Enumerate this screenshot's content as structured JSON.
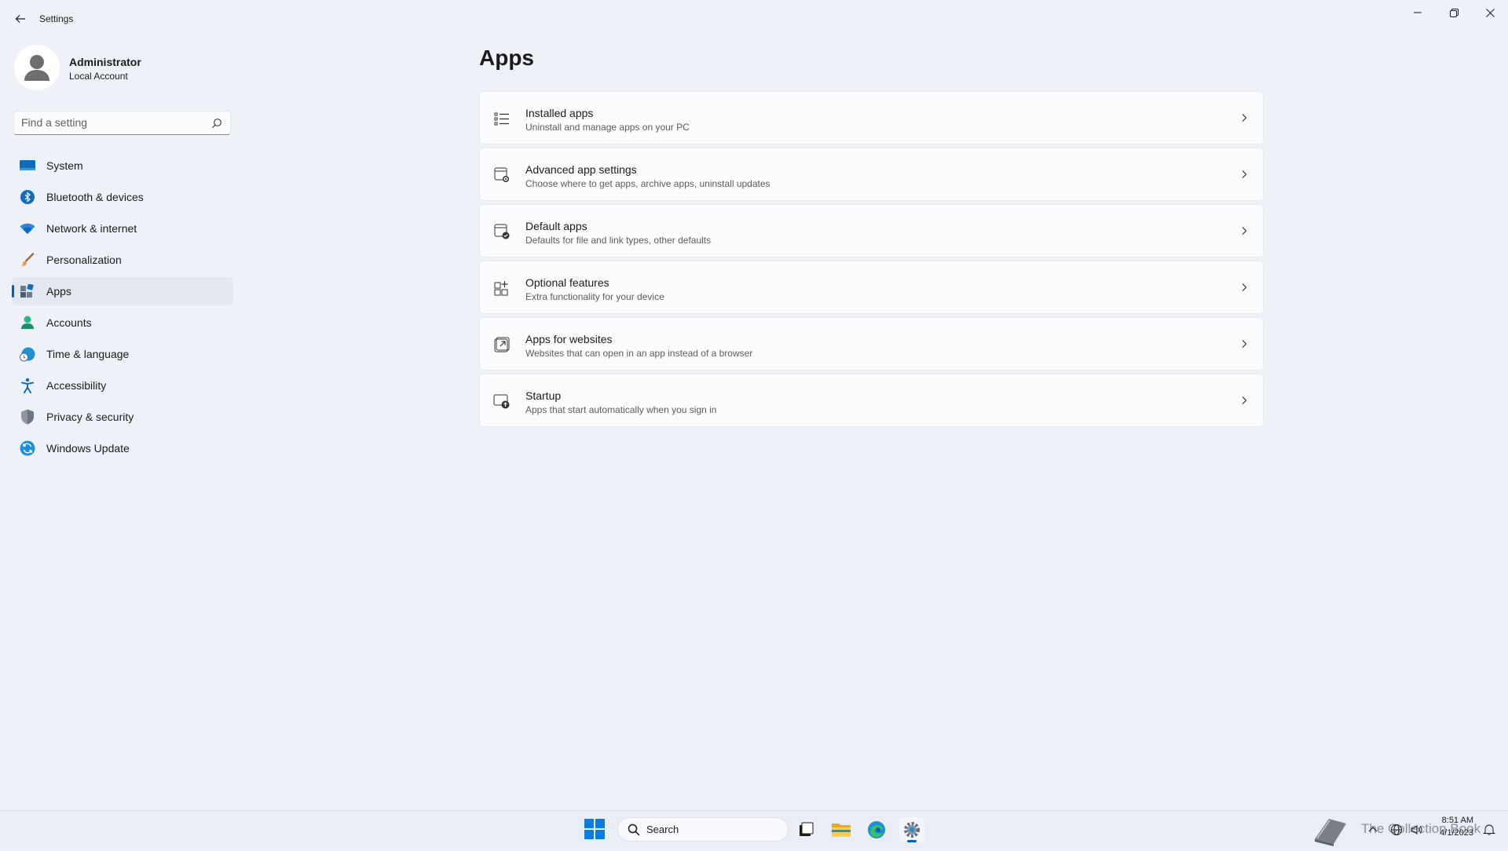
{
  "window": {
    "title": "Settings"
  },
  "profile": {
    "name": "Administrator",
    "account_type": "Local Account"
  },
  "search": {
    "placeholder": "Find a setting"
  },
  "nav": {
    "items": [
      {
        "label": "System",
        "icon": "system-icon",
        "active": false
      },
      {
        "label": "Bluetooth & devices",
        "icon": "bluetooth-icon",
        "active": false
      },
      {
        "label": "Network & internet",
        "icon": "wifi-icon",
        "active": false
      },
      {
        "label": "Personalization",
        "icon": "brush-icon",
        "active": false
      },
      {
        "label": "Apps",
        "icon": "apps-icon",
        "active": true
      },
      {
        "label": "Accounts",
        "icon": "accounts-icon",
        "active": false
      },
      {
        "label": "Time & language",
        "icon": "clock-globe-icon",
        "active": false
      },
      {
        "label": "Accessibility",
        "icon": "accessibility-icon",
        "active": false
      },
      {
        "label": "Privacy & security",
        "icon": "shield-icon",
        "active": false
      },
      {
        "label": "Windows Update",
        "icon": "update-icon",
        "active": false
      }
    ]
  },
  "main": {
    "title": "Apps",
    "cards": [
      {
        "title": "Installed apps",
        "subtitle": "Uninstall and manage apps on your PC",
        "icon": "list-icon"
      },
      {
        "title": "Advanced app settings",
        "subtitle": "Choose where to get apps, archive apps, uninstall updates",
        "icon": "app-gear-icon"
      },
      {
        "title": "Default apps",
        "subtitle": "Defaults for file and link types, other defaults",
        "icon": "default-apps-icon"
      },
      {
        "title": "Optional features",
        "subtitle": "Extra functionality for your device",
        "icon": "grid-plus-icon"
      },
      {
        "title": "Apps for websites",
        "subtitle": "Websites that can open in an app instead of a browser",
        "icon": "open-external-icon"
      },
      {
        "title": "Startup",
        "subtitle": "Apps that start automatically when you sign in",
        "icon": "startup-icon"
      }
    ]
  },
  "taskbar": {
    "search_label": "Search",
    "watermark": "The Collection Book",
    "time": "8:51 AM",
    "date": "4/1/2023"
  },
  "colors": {
    "accent": "#005fb8",
    "background": "#eef2f8"
  }
}
